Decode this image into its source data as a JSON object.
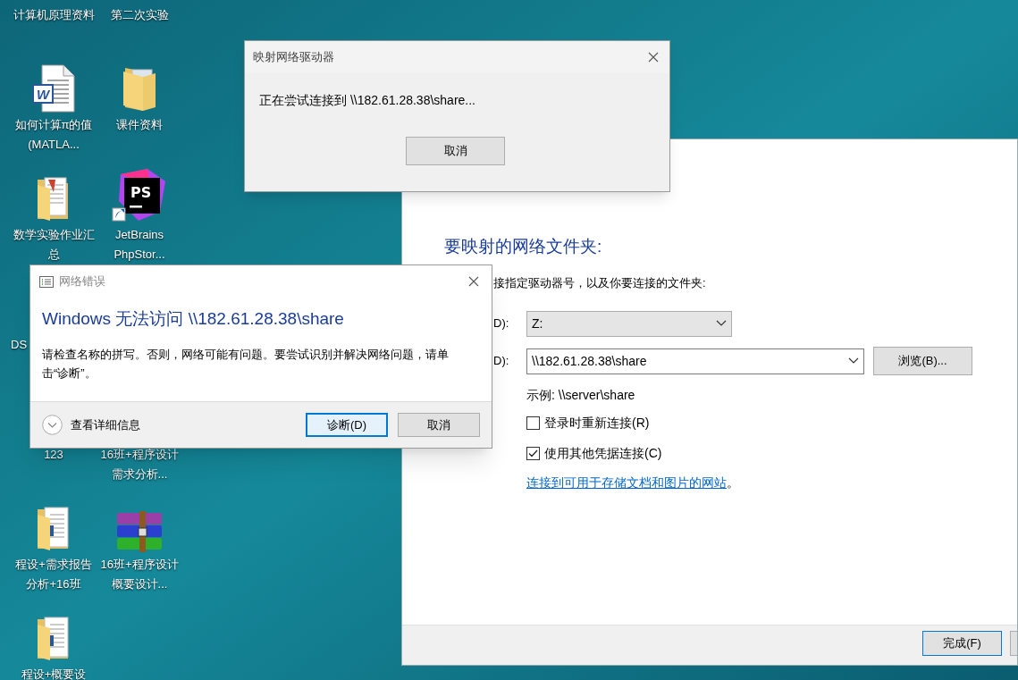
{
  "desktop_rows": [
    [
      {
        "label": "计算机原理资料",
        "kind": "covered"
      },
      {
        "label": "第二次实验",
        "kind": "covered"
      }
    ],
    [
      {
        "label": "如何计算π的值(MATLA...",
        "kind": "worddoc",
        "icon_text": "W"
      },
      {
        "label": "课件资料",
        "kind": "folder"
      }
    ],
    [
      {
        "label": "数学实验作业汇总",
        "kind": "docfolder"
      },
      {
        "label": "JetBrains PhpStor...",
        "kind": "ide",
        "icon_text": "PS"
      }
    ],
    [
      {
        "label": "DS",
        "kind": "cut"
      }
    ],
    [
      {
        "label": "123",
        "kind": "covered"
      },
      {
        "label": "16班+程序设计需求分析...",
        "kind": "covered"
      }
    ],
    [
      {
        "label": "程设+需求报告分析+16班",
        "kind": "wordfolder"
      },
      {
        "label": "16班+程序设计概要设计...",
        "kind": "archive"
      }
    ],
    [
      {
        "label": "程设+概要设",
        "kind": "wordfolder"
      }
    ]
  ],
  "map_drive_wizard": {
    "heading": "要映射的网络文件夹:",
    "instruction": "接指定驱动器号，以及你要连接的文件夹:",
    "drive_label": "D):",
    "drive_value": "Z:",
    "folder_label": "D):",
    "folder_value": "\\\\182.61.28.38\\share",
    "browse_button": "浏览(B)...",
    "example": "示例: \\\\server\\share",
    "checkboxes": [
      {
        "label": "登录时重新连接(R)",
        "checked": false
      },
      {
        "label": "使用其他凭据连接(C)",
        "checked": true
      }
    ],
    "link": "连接到可用于存储文档和图片的网站",
    "link_suffix": "。",
    "finish_button": "完成(F)"
  },
  "connecting_dialog": {
    "title": "映射网络驱动器",
    "message": "正在尝试连接到 \\\\182.61.28.38\\share...",
    "cancel_button": "取消"
  },
  "error_dialog": {
    "title": "网络错误",
    "heading": "Windows 无法访问 \\\\182.61.28.38\\share",
    "body": "请检查名称的拼写。否则，网络可能有问题。要尝试识别并解决网络问题，请单击“诊断”。",
    "details": "查看详细信息",
    "buttons": [
      {
        "label": "诊断(D)",
        "selected": true
      },
      {
        "label": "取消",
        "selected": false
      }
    ]
  }
}
